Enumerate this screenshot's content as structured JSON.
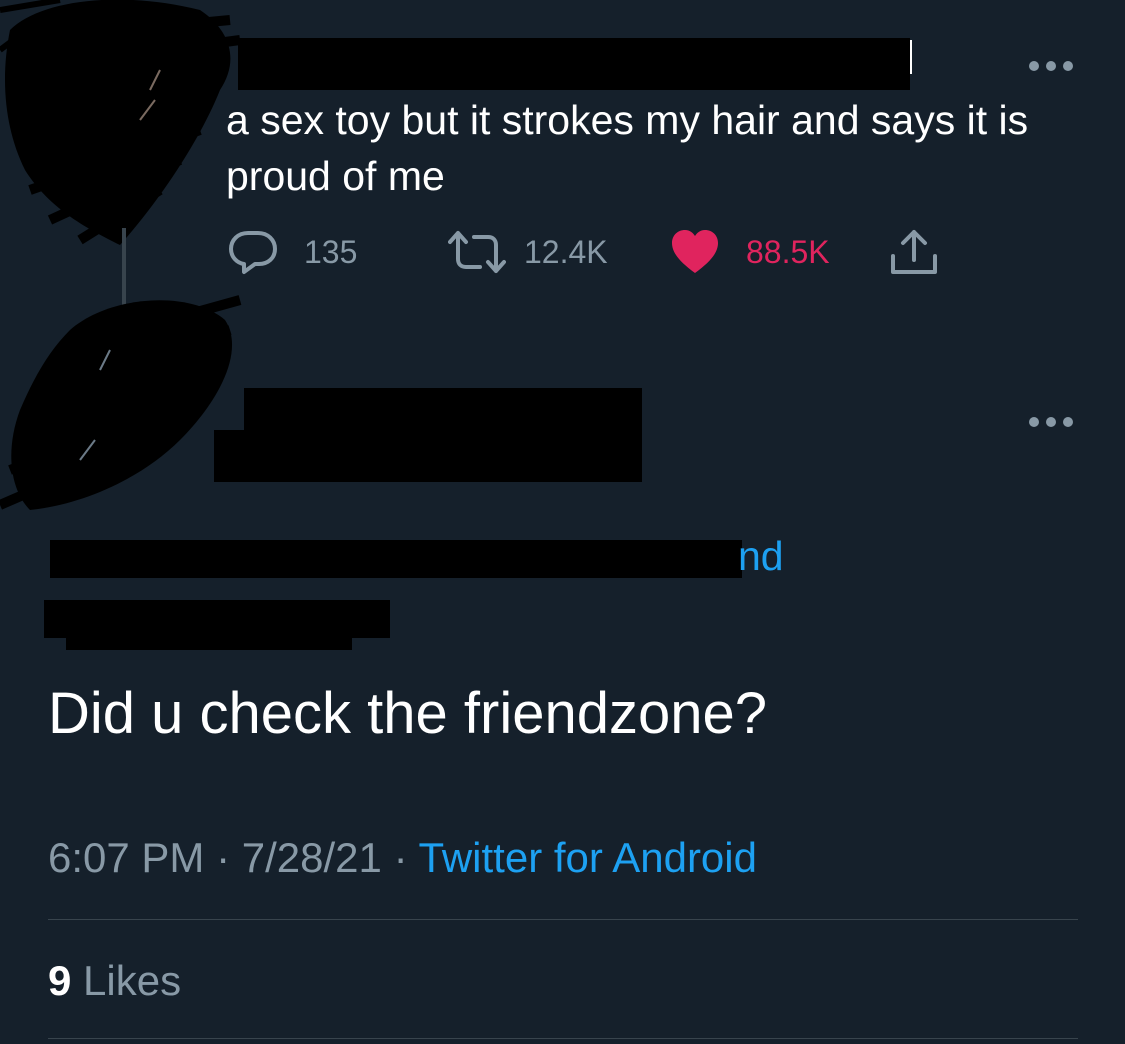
{
  "parent_tweet": {
    "text": "a sex toy but it strokes my hair and says it is proud of me",
    "reply_count": "135",
    "retweet_count": "12.4K",
    "like_count": "88.5K",
    "more_icon": "more-horizontal-icon"
  },
  "reply_tweet": {
    "replying_to_visible_fragment": "nd",
    "text": "Did u check the friendzone?",
    "time": "6:07 PM",
    "date": "7/28/21",
    "separator": "·",
    "source": "Twitter for Android",
    "likes_count": "9",
    "likes_label": "Likes",
    "more_icon": "more-horizontal-icon"
  },
  "colors": {
    "background": "#15202b",
    "text_primary": "#ffffff",
    "text_secondary": "#8899a6",
    "accent_blue": "#1da1f2",
    "like_red": "#e0245e",
    "divider": "#38444d"
  }
}
